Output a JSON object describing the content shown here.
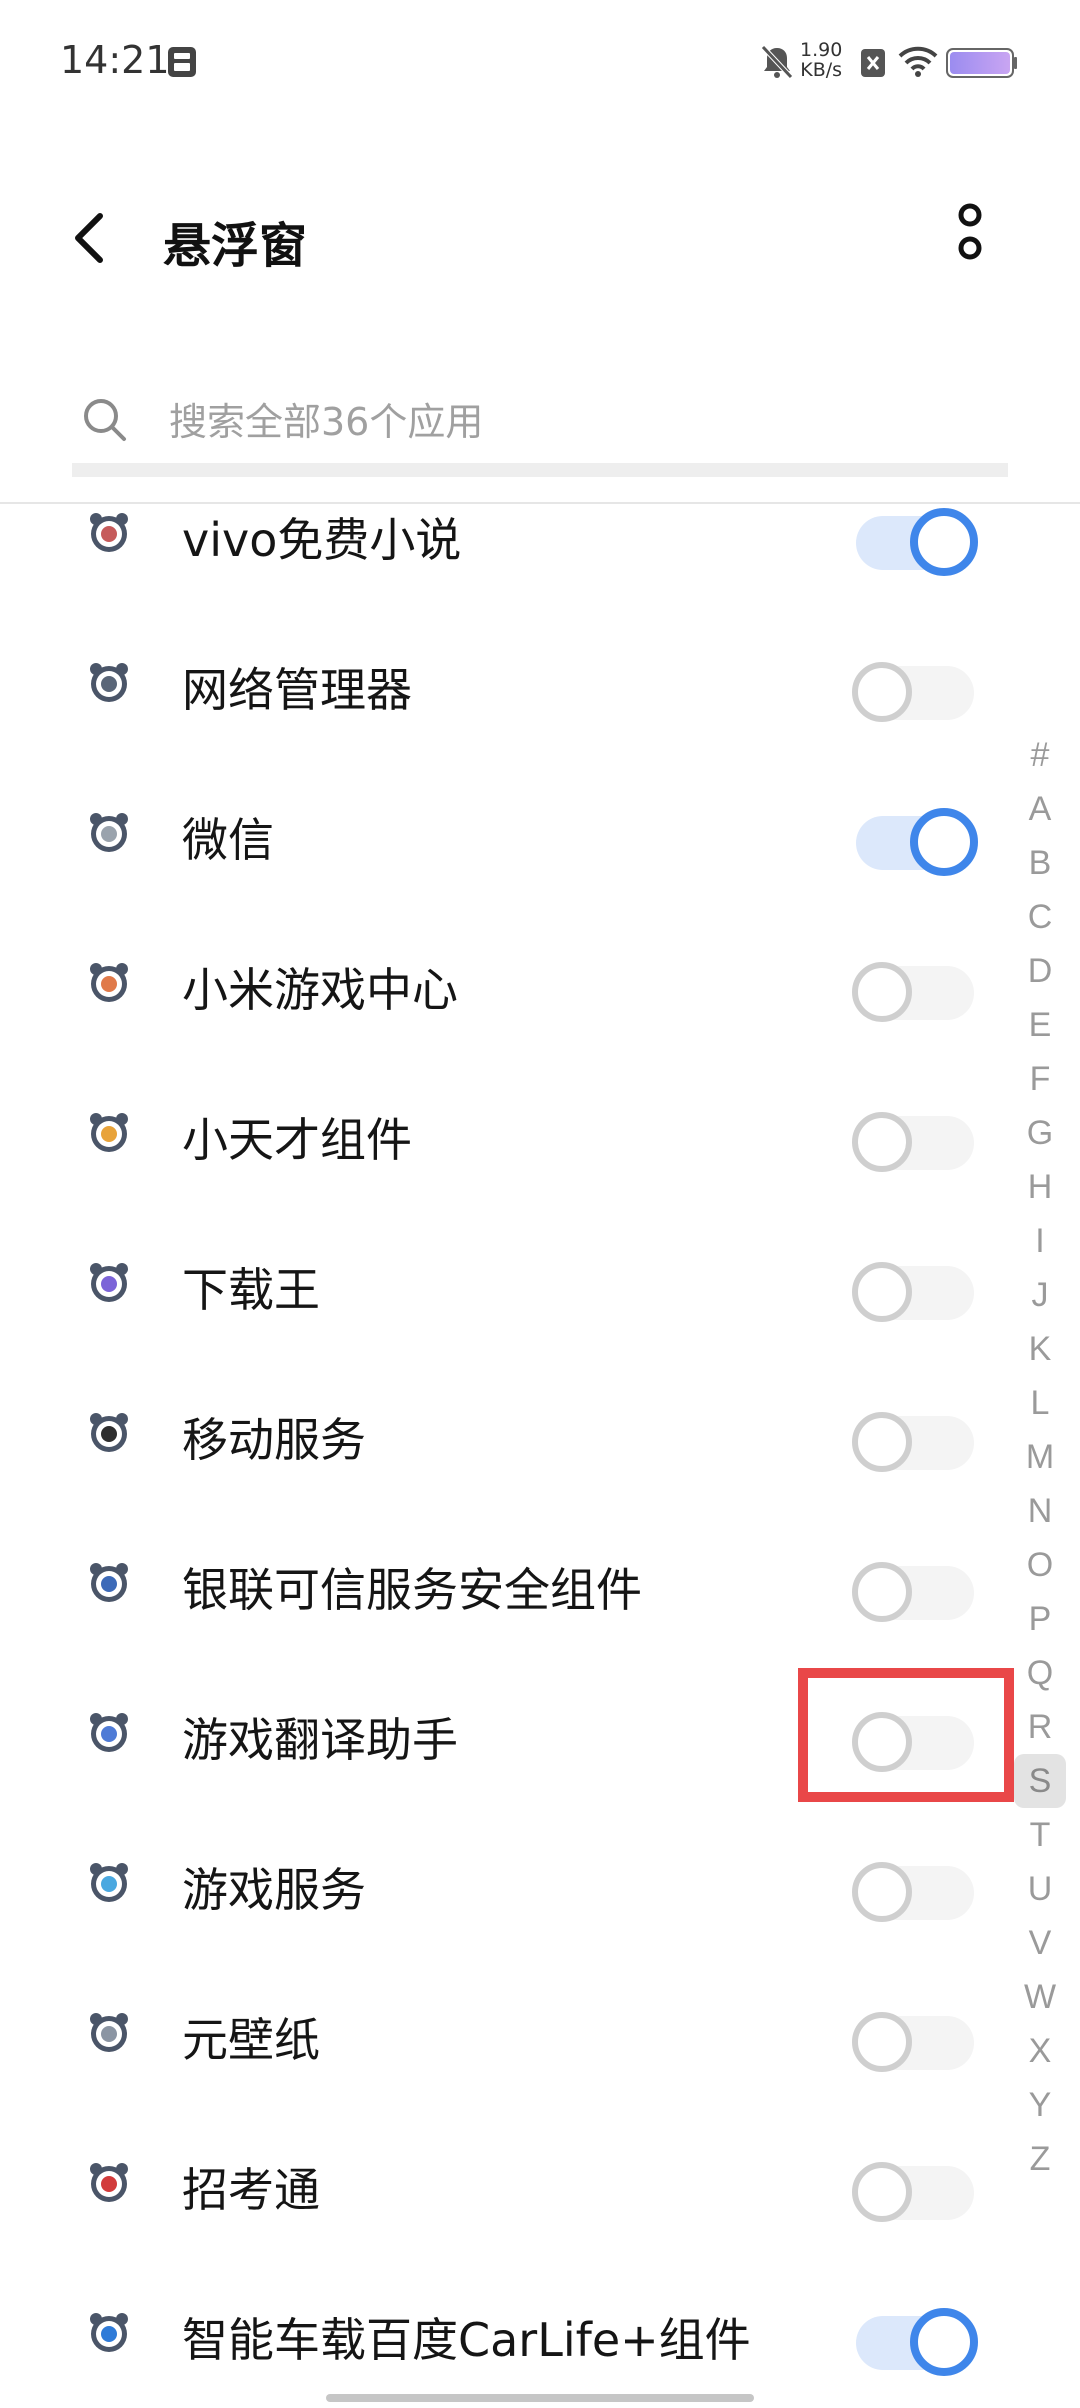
{
  "status_bar": {
    "time": "14:21",
    "net_speed_value": "1.90",
    "net_speed_unit": "KB/s",
    "icons": [
      "sim-card-icon",
      "mute-bell-icon",
      "no-sim-icon",
      "wifi-icon",
      "battery-icon"
    ]
  },
  "header": {
    "title": "悬浮窗",
    "back_icon": "chevron-left-icon",
    "more_icon": "more-vertical-icon"
  },
  "search": {
    "placeholder": "搜索全部36个应用",
    "icon": "search-icon"
  },
  "apps": [
    {
      "label": "vivo免费小说",
      "enabled": true,
      "icon_color": "#c65b5b"
    },
    {
      "label": "网络管理器",
      "enabled": false,
      "icon_color": "#5a6678"
    },
    {
      "label": "微信",
      "enabled": true,
      "icon_color": "#9aa3ad"
    },
    {
      "label": "小米游戏中心",
      "enabled": false,
      "icon_color": "#e07a4a"
    },
    {
      "label": "小天才组件",
      "enabled": false,
      "icon_color": "#e8a33a"
    },
    {
      "label": "下载王",
      "enabled": false,
      "icon_color": "#7c64d8"
    },
    {
      "label": "移动服务",
      "enabled": false,
      "icon_color": "#2e2e2e"
    },
    {
      "label": "银联可信服务安全组件",
      "enabled": false,
      "icon_color": "#3d6ab8"
    },
    {
      "label": "游戏翻译助手",
      "enabled": false,
      "icon_color": "#4f7bd6"
    },
    {
      "label": "游戏服务",
      "enabled": false,
      "icon_color": "#4aa8e0"
    },
    {
      "label": "元壁纸",
      "enabled": false,
      "icon_color": "#8b95a3"
    },
    {
      "label": "招考通",
      "enabled": false,
      "icon_color": "#d23b3b"
    },
    {
      "label": "智能车载百度CarLife+组件",
      "enabled": true,
      "icon_color": "#2f7bd8"
    }
  ],
  "alphabet": [
    "#",
    "A",
    "B",
    "C",
    "D",
    "E",
    "F",
    "G",
    "H",
    "I",
    "J",
    "K",
    "L",
    "M",
    "N",
    "O",
    "P",
    "Q",
    "R",
    "S",
    "T",
    "U",
    "V",
    "W",
    "X",
    "Y",
    "Z"
  ],
  "alphabet_active": "S",
  "colors": {
    "accent": "#3f86ea",
    "highlight": "#e94748",
    "switch_off_border": "#cfcfcf"
  }
}
